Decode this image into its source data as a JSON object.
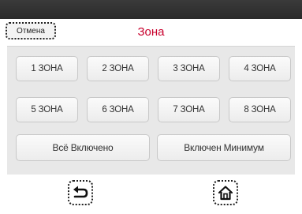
{
  "header": {
    "cancel_label": "Отмена",
    "title": "Зона"
  },
  "zones": [
    {
      "label": "1 ЗОНА"
    },
    {
      "label": "2 ЗОНА"
    },
    {
      "label": "3 ЗОНА"
    },
    {
      "label": "4 ЗОНА"
    },
    {
      "label": "5 ЗОНА"
    },
    {
      "label": "6 ЗОНА"
    },
    {
      "label": "7 ЗОНА"
    },
    {
      "label": "8 ЗОНА"
    }
  ],
  "actions": {
    "all_on_label": "Всё Включено",
    "minimum_label": "Включен Минимум"
  },
  "footer": {
    "back_icon": "back-arrow-icon",
    "home_icon": "home-icon"
  },
  "colors": {
    "title": "#c8002c",
    "topbar": "#2f2f2f",
    "panel": "#e8e8e8"
  }
}
